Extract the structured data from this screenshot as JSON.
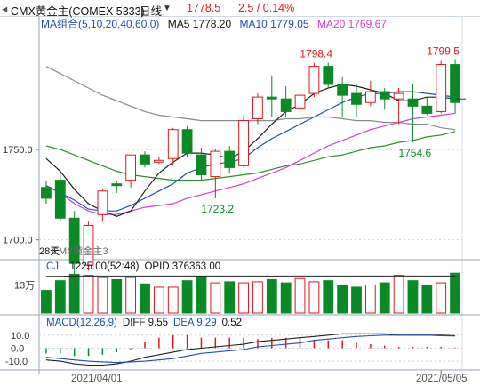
{
  "header": {
    "instrument": "CMX黄金主(COMEX 5333)",
    "period": "日线",
    "price": "1778.5",
    "change": "2.5 / 0.14%",
    "colors": {
      "up": "#e0161b",
      "down": "#0a8a24",
      "blue": "#1f4fb4",
      "ma20": "#d23cd4"
    }
  },
  "ma_legend": {
    "label": "MA组合(5,10,20,40,60,0)",
    "ma5": "MA5 1778.20",
    "ma10": "MA10 1779.05",
    "ma20": "MA20 1769.67"
  },
  "vol_legend": {
    "label": "CJL",
    "values": "1225.00(52:48)",
    "opid": "OPID 376363.00"
  },
  "macd_legend": {
    "label": "MACD(12,26,9)",
    "diff": "DIFF 9.55",
    "dea": "DEA 9.29",
    "macd": "0.52"
  },
  "main_labels": {
    "ticks": [
      "1750.0",
      "1700.0"
    ],
    "days_label": "28天",
    "overlap_text": "CMX黄金主3",
    "ann_high1": "1798.4",
    "ann_high2": "1799.5",
    "ann_low1": "1754.6",
    "ann_low2": "1723.2"
  },
  "vol_labels": {
    "tick": "13万"
  },
  "macd_labels": {
    "ticks": [
      "10.0",
      "0.0",
      "-10.0"
    ]
  },
  "dates": [
    "2021/04/01",
    "2021/05/05"
  ],
  "chart_data": {
    "type": "candlestick",
    "ylim": [
      1690,
      1815
    ],
    "yticks": [
      1750,
      1700
    ],
    "candles": [
      {
        "o": 1729,
        "h": 1733,
        "l": 1720,
        "c": 1723
      },
      {
        "o": 1733,
        "h": 1737,
        "l": 1710,
        "c": 1712
      },
      {
        "o": 1712,
        "h": 1716,
        "l": 1680,
        "c": 1687
      },
      {
        "o": 1686,
        "h": 1710,
        "l": 1683,
        "c": 1708
      },
      {
        "o": 1714,
        "h": 1728,
        "l": 1710,
        "c": 1727
      },
      {
        "o": 1731,
        "h": 1733,
        "l": 1726,
        "c": 1730
      },
      {
        "o": 1733,
        "h": 1747,
        "l": 1729,
        "c": 1747
      },
      {
        "o": 1747,
        "h": 1749,
        "l": 1740,
        "c": 1742
      },
      {
        "o": 1743,
        "h": 1746,
        "l": 1742,
        "c": 1744
      },
      {
        "o": 1745,
        "h": 1762,
        "l": 1741,
        "c": 1761
      },
      {
        "o": 1761,
        "h": 1763,
        "l": 1746,
        "c": 1748
      },
      {
        "o": 1747,
        "h": 1751,
        "l": 1733,
        "c": 1736
      },
      {
        "o": 1735,
        "h": 1750,
        "l": 1723,
        "c": 1749
      },
      {
        "o": 1749,
        "h": 1752,
        "l": 1737,
        "c": 1740
      },
      {
        "o": 1741,
        "h": 1769,
        "l": 1740,
        "c": 1766
      },
      {
        "o": 1767,
        "h": 1781,
        "l": 1764,
        "c": 1779
      },
      {
        "o": 1779,
        "h": 1791,
        "l": 1768,
        "c": 1778
      },
      {
        "o": 1778,
        "h": 1785,
        "l": 1768,
        "c": 1771
      },
      {
        "o": 1773,
        "h": 1789,
        "l": 1770,
        "c": 1780
      },
      {
        "o": 1781,
        "h": 1798,
        "l": 1779,
        "c": 1796
      },
      {
        "o": 1796,
        "h": 1798,
        "l": 1784,
        "c": 1786
      },
      {
        "o": 1786,
        "h": 1790,
        "l": 1768,
        "c": 1780
      },
      {
        "o": 1781,
        "h": 1786,
        "l": 1768,
        "c": 1775
      },
      {
        "o": 1776,
        "h": 1788,
        "l": 1774,
        "c": 1782
      },
      {
        "o": 1782,
        "h": 1784,
        "l": 1772,
        "c": 1778
      },
      {
        "o": 1778,
        "h": 1784,
        "l": 1764,
        "c": 1781
      },
      {
        "o": 1778,
        "h": 1786,
        "l": 1754,
        "c": 1774
      },
      {
        "o": 1774,
        "h": 1779,
        "l": 1769,
        "c": 1770
      },
      {
        "o": 1771,
        "h": 1799,
        "l": 1770,
        "c": 1797
      },
      {
        "o": 1797,
        "h": 1800,
        "l": 1770,
        "c": 1776
      }
    ],
    "ma5": [
      1745,
      1738,
      1728,
      1720,
      1716,
      1713,
      1716,
      1727,
      1737,
      1743,
      1748,
      1748,
      1747,
      1745,
      1749,
      1756,
      1764,
      1771,
      1775,
      1781,
      1784,
      1786,
      1785,
      1783,
      1781,
      1777,
      1777,
      1779,
      1779,
      1778
    ],
    "ma10": [
      1730,
      1726,
      1722,
      1717,
      1716,
      1716,
      1719,
      1723,
      1727,
      1731,
      1737,
      1740,
      1742,
      1743,
      1745,
      1751,
      1756,
      1760,
      1764,
      1768,
      1772,
      1776,
      1779,
      1781,
      1781,
      1782,
      1782,
      1781,
      1780,
      1779
    ],
    "ma20": [
      1730,
      1726,
      1720,
      1716,
      1714,
      1714,
      1716,
      1718,
      1719,
      1720,
      1723,
      1725,
      1727,
      1729,
      1731,
      1734,
      1737,
      1740,
      1744,
      1748,
      1752,
      1755,
      1758,
      1761,
      1763,
      1765,
      1767,
      1768,
      1769,
      1770
    ],
    "ma40": [
      1752,
      1750,
      1747,
      1744,
      1741,
      1738,
      1736,
      1735,
      1734,
      1733,
      1733,
      1733,
      1734,
      1735,
      1736,
      1737,
      1739,
      1741,
      1742,
      1744,
      1746,
      1747,
      1749,
      1751,
      1752,
      1754,
      1755,
      1757,
      1758,
      1760
    ],
    "ma60": [
      1796,
      1792,
      1788,
      1784,
      1780,
      1777,
      1774,
      1771,
      1769,
      1768,
      1767,
      1766,
      1766,
      1766,
      1766,
      1766,
      1766,
      1767,
      1767,
      1768,
      1768,
      1767,
      1766,
      1766,
      1765,
      1765,
      1764,
      1764,
      1762,
      1761
    ],
    "volume": {
      "ymax": 190000,
      "tick": 130000,
      "values": [
        105000,
        150000,
        180000,
        175000,
        165000,
        155000,
        165000,
        135000,
        120000,
        120000,
        150000,
        170000,
        140000,
        145000,
        140000,
        145000,
        155000,
        140000,
        160000,
        145000,
        150000,
        130000,
        120000,
        130000,
        140000,
        175000,
        150000,
        130000,
        140000,
        185000
      ],
      "opid": [
        170000,
        170000,
        172000,
        172000,
        172000,
        172000,
        172000,
        172000,
        172000,
        172000,
        172000,
        172000,
        172000,
        172000,
        172000,
        172000,
        172000,
        172000,
        172000,
        172000,
        172000,
        172000,
        172000,
        172000,
        172000,
        172000,
        172000,
        172000,
        172000,
        172000
      ]
    },
    "macd": {
      "ylim": [
        -14,
        16
      ],
      "yticks": [
        10,
        0,
        -10
      ],
      "diff": [
        -9,
        -10,
        -12,
        -13,
        -13,
        -12,
        -10,
        -7,
        -5,
        -3,
        -1,
        0,
        1,
        2,
        3,
        5,
        6,
        7,
        8,
        9,
        10,
        11,
        11,
        11,
        11,
        10,
        10,
        10,
        10,
        9.6
      ],
      "dea": [
        -7,
        -8,
        -9,
        -10,
        -10.5,
        -11,
        -10.5,
        -10,
        -9,
        -8,
        -6,
        -4,
        -3,
        -2,
        -1,
        1,
        2,
        3,
        4,
        6,
        7,
        8,
        9,
        9.5,
        10,
        10,
        10,
        10,
        9.5,
        9.3
      ],
      "hist": [
        -4,
        -4,
        -6,
        -6,
        -5,
        -3,
        -1,
        5,
        8,
        10,
        10,
        8,
        8,
        8,
        8,
        7,
        8,
        8,
        8,
        6,
        6,
        6,
        4,
        3,
        2,
        1,
        1,
        1,
        1,
        0.5
      ]
    }
  }
}
